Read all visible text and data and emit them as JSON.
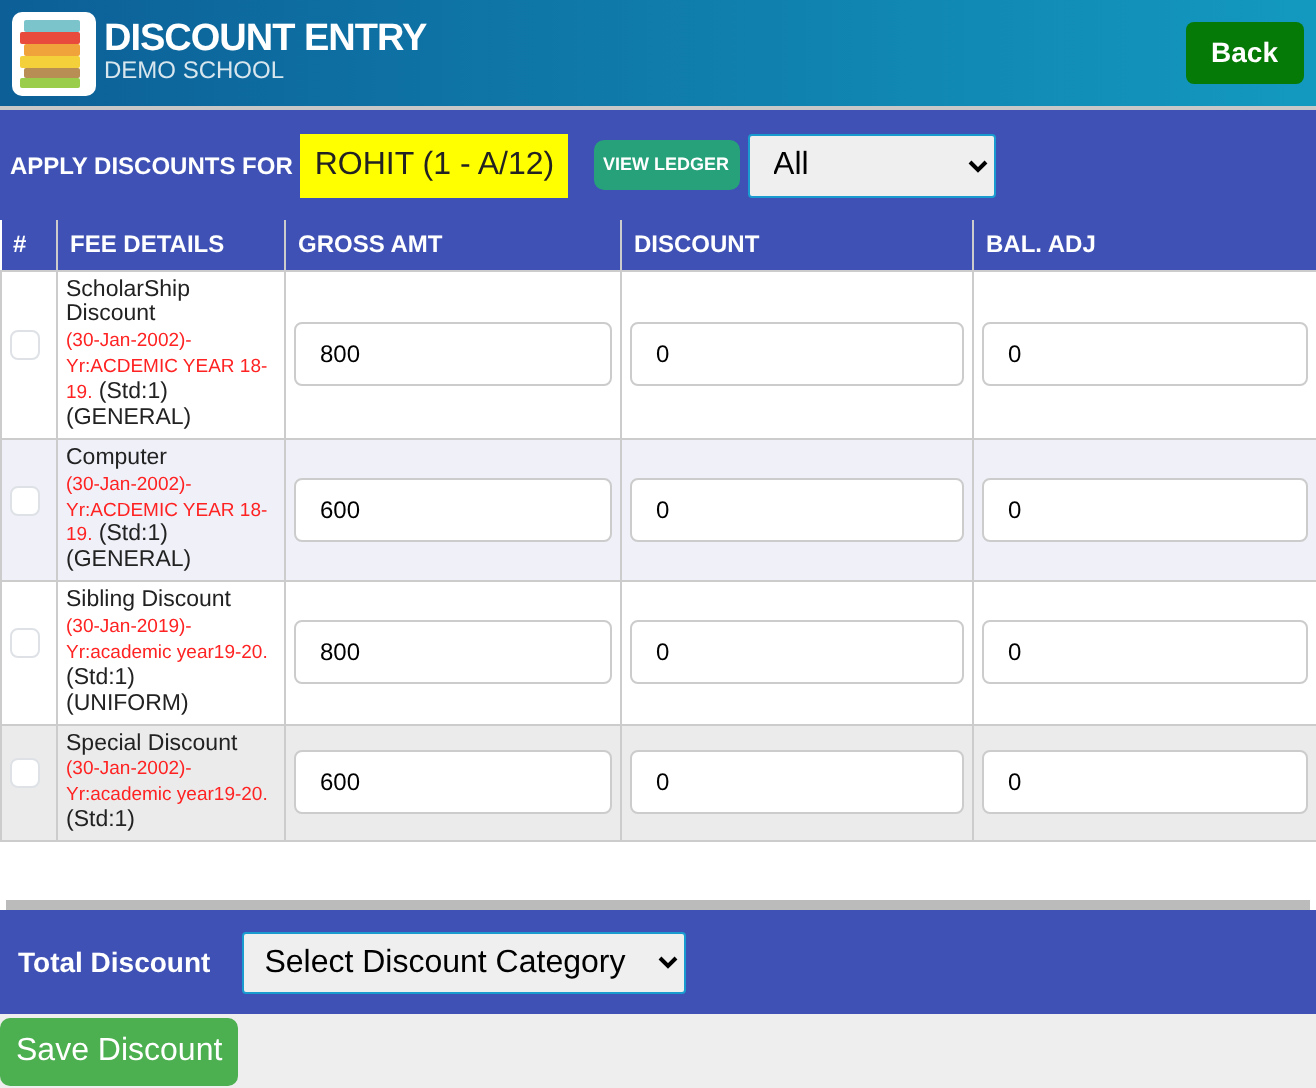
{
  "header": {
    "title": "DISCOUNT ENTRY",
    "subtitle": "DEMO SCHOOL",
    "back_button": "Back"
  },
  "apply_bar": {
    "label": "APPLY DISCOUNTS FOR",
    "student": "ROHIT (1 - A/12)",
    "ledger_button": "VIEW LEDGER",
    "filter": "All"
  },
  "table": {
    "columns": [
      "#",
      "FEE DETAILS",
      "GROSS AMT",
      "DISCOUNT",
      "BAL. ADJ"
    ],
    "rows": [
      {
        "checked": false,
        "hovered": false,
        "fee_name": "ScholarShip Discount",
        "period": "(30-Jan-2002)-Yr:ACDEMIC YEAR 18-19.",
        "std": "(Std:1)",
        "category": "(GENERAL)",
        "gross": "800",
        "discount": "0",
        "bal_adj": "0"
      },
      {
        "checked": false,
        "hovered": false,
        "fee_name": "Computer",
        "period": "(30-Jan-2002)-Yr:ACDEMIC YEAR 18-19.",
        "std": "(Std:1)",
        "category": "(GENERAL)",
        "gross": "600",
        "discount": "0",
        "bal_adj": "0"
      },
      {
        "checked": false,
        "hovered": false,
        "fee_name": "Sibling Discount",
        "period": "(30-Jan-2019)-Yr:academic year19-20.",
        "std": "(Std:1)",
        "category": "(UNIFORM)",
        "gross": "800",
        "discount": "0",
        "bal_adj": "0"
      },
      {
        "checked": false,
        "hovered": true,
        "fee_name": "Special Discount",
        "period": "(30-Jan-2002)-Yr:academic year19-20.",
        "std": "(Std:1)",
        "gross": "600",
        "discount": "0",
        "bal_adj": "0"
      }
    ]
  },
  "total_bar": {
    "label": "Total Discount",
    "category_select": "Select Discount Category"
  },
  "save_button": "Save Discount"
}
